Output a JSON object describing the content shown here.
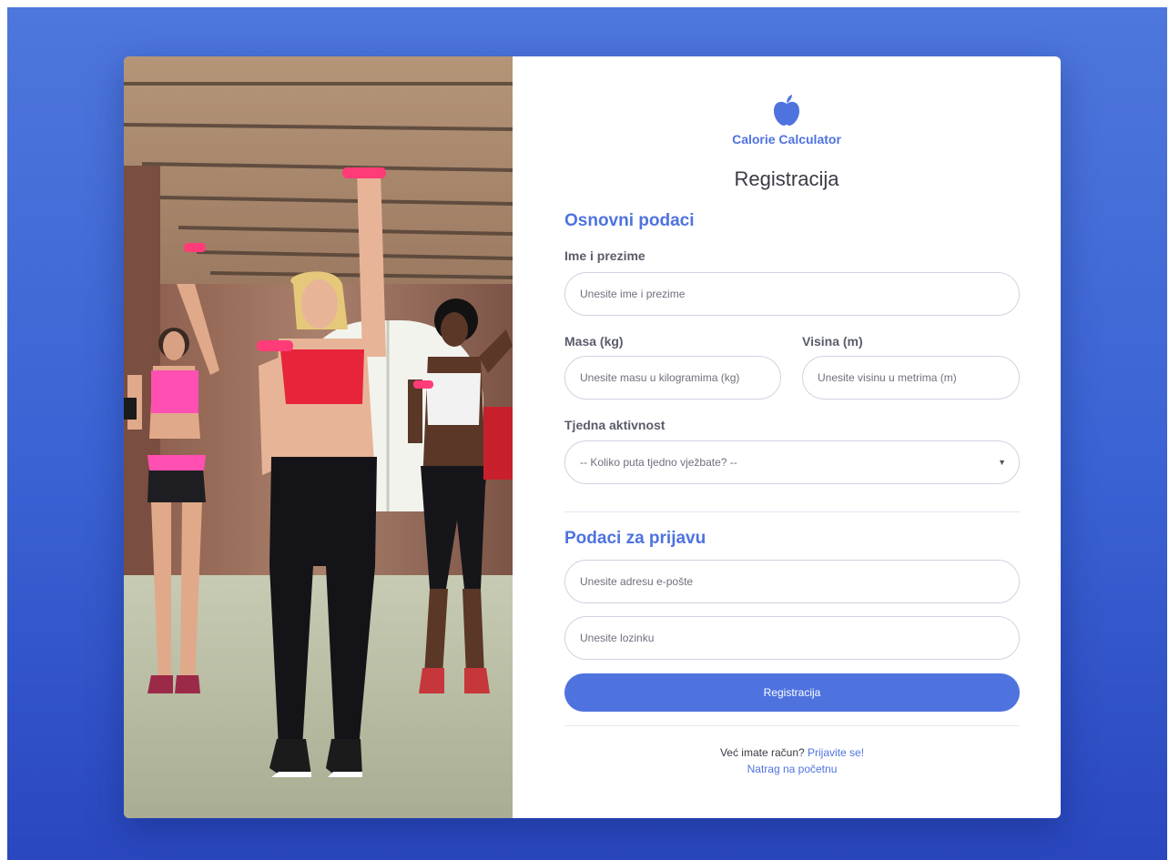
{
  "app": {
    "name": "Calorie Calculator",
    "logo_icon": "apple-icon",
    "accent_color": "#4e73df"
  },
  "form": {
    "title": "Registracija",
    "basic_section": {
      "heading": "Osnovni podaci",
      "full_name": {
        "label": "Ime i prezime",
        "placeholder": "Unesite ime i prezime",
        "value": ""
      },
      "weight": {
        "label": "Masa (kg)",
        "placeholder": "Unesite masu u kilogramima (kg)",
        "value": ""
      },
      "height": {
        "label": "Visina (m)",
        "placeholder": "Unesite visinu u metrima (m)",
        "value": ""
      },
      "activity": {
        "label": "Tjedna aktivnost",
        "selected": "-- Koliko puta tjedno vježbate? --"
      }
    },
    "login_section": {
      "heading": "Podaci za prijavu",
      "email": {
        "placeholder": "Unesite adresu e-pošte",
        "value": ""
      },
      "password": {
        "placeholder": "Unesite lozinku",
        "value": ""
      }
    },
    "submit_label": "Registracija"
  },
  "footer": {
    "have_account_text": "Već imate račun?",
    "login_link": "Prijavite se!",
    "home_link": "Natrag na početnu"
  }
}
